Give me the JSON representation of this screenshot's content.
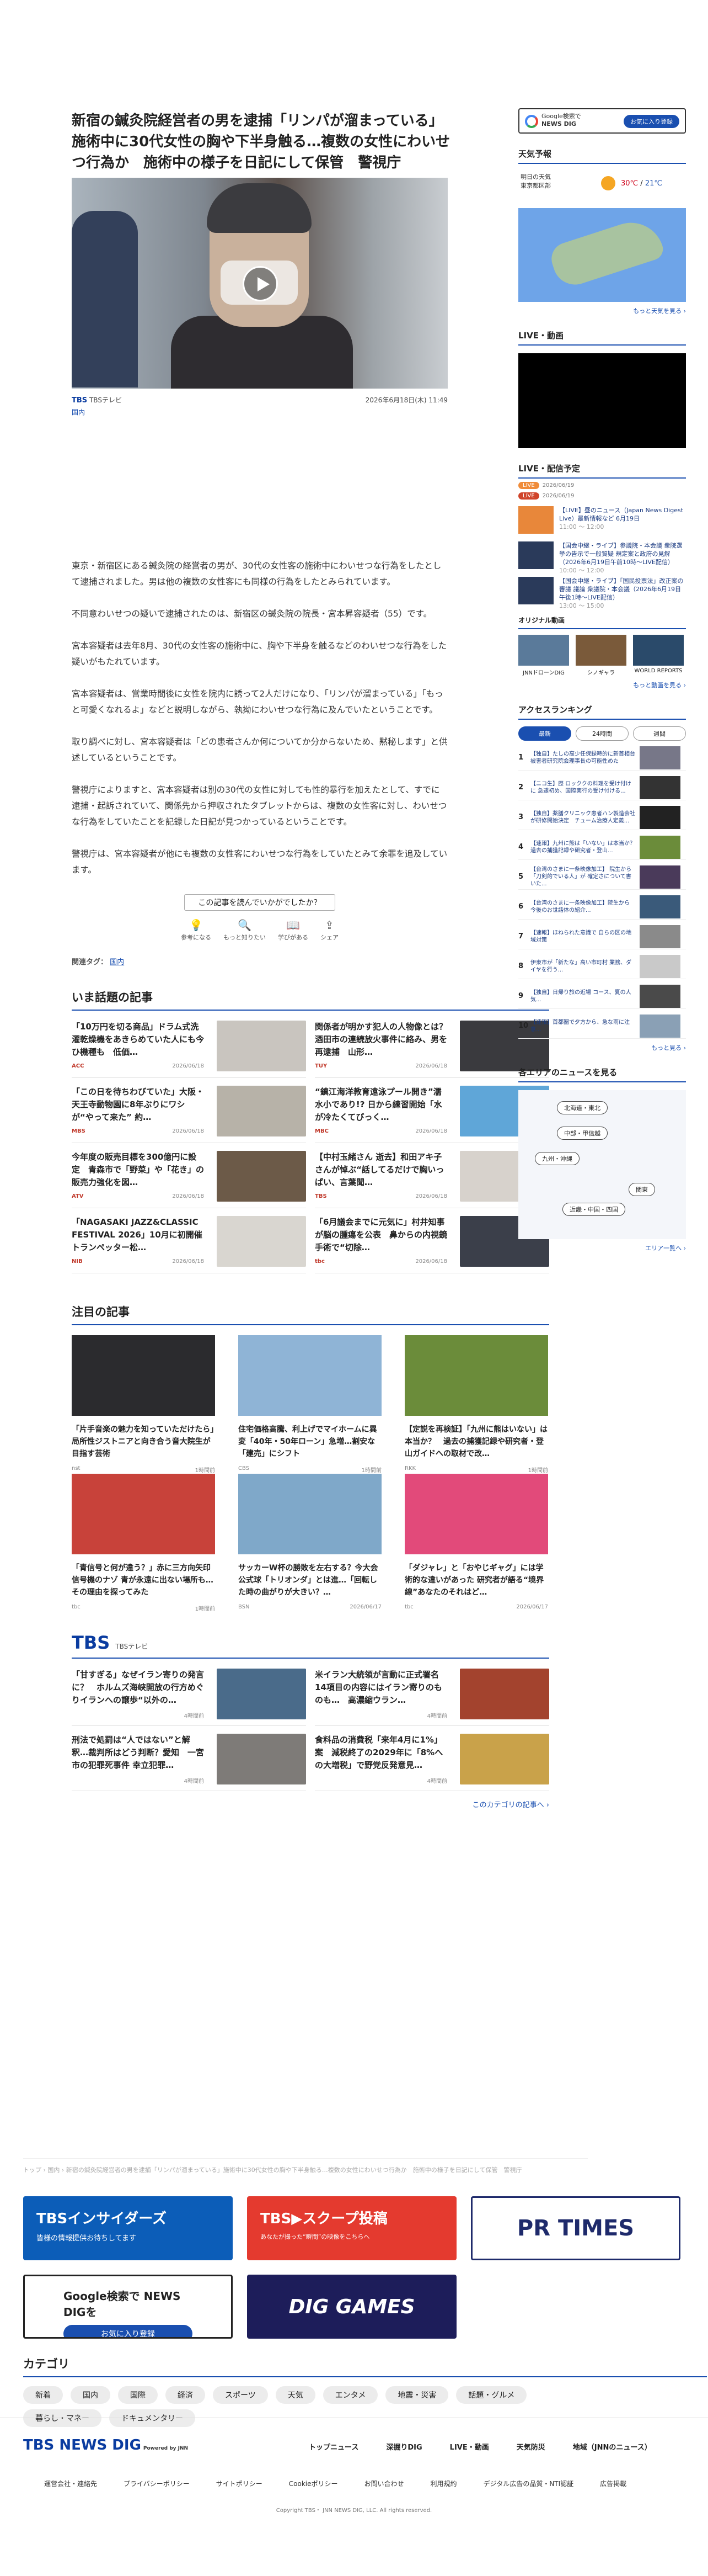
{
  "article": {
    "headline": "新宿の鍼灸院経営者の男を逮捕「リンパが溜まっている」施術中に30代女性の胸や下半身触る…複数の女性にわいせつ行為か　施術中の様子を日記にして保管　警視庁",
    "source_logo": "TBS",
    "source": "TBSテレビ",
    "date": "2026年6月18日(木) 11:49",
    "category": "国内",
    "paragraphs": [
      "東京・新宿区にある鍼灸院の経営者の男が、30代の女性客の施術中にわいせつな行為をしたとして逮捕されました。男は他の複数の女性客にも同様の行為をしたとみられています。",
      "不同意わいせつの疑いで逮捕されたのは、新宿区の鍼灸院の院長・宮本昇容疑者（55）です。",
      "宮本容疑者は去年8月、30代の女性客の施術中に、胸や下半身を触るなどのわいせつな行為をした疑いがもたれています。",
      "宮本容疑者は、営業時間後に女性を院内に誘って2人だけになり、「リンパが溜まっている」「もっと可愛くなれるよ」などと説明しながら、執拗にわいせつな行為に及んでいたということです。",
      "取り調べに対し、宮本容疑者は「どの患者さんか何についてか分からないため、黙秘します」と供述しているということです。",
      "警視庁によりますと、宮本容疑者は別の30代の女性に対しても性的暴行を加えたとして、すでに逮捕・起訴されていて、関係先から押収されたタブレットからは、複数の女性客に対し、わいせつな行為をしていたことを記録した日記が見つかっているということです。",
      "警視庁は、宮本容疑者が他にも複数の女性客にわいせつな行為をしていたとみて余罪を追及しています。"
    ],
    "survey_question": "この記事を読んでいかがでしたか？",
    "reactions": [
      "参考になる",
      "もっと知りたい",
      "学びがある",
      "シェア"
    ],
    "related_label": "関連タグ：",
    "related_tag": "国内"
  },
  "trending": {
    "title": "いま話題の記事",
    "items": [
      {
        "title": "「10万円を切る商品」ドラム式洗濯乾燥機をあきらめていた人にも今ひ機種も　低価…",
        "source": "ACC",
        "date": "2026/06/18"
      },
      {
        "title": "関係者が明かす犯人の人物像とは？ 酒田市の連続放火事件に絡み、男を再逮捕　山形…",
        "source": "TUY",
        "date": "2026/06/18"
      },
      {
        "title": "「この日を待ちわびていた」大阪・天王寺動物園に8年ぶりにワシが“やって来た” 約…",
        "source": "MBS",
        "date": "2026/06/18"
      },
      {
        "title": "“鎮江海洋教育遠泳プール開き”濡水小であり!? 日から練習開始「水が冷たくてびっく…",
        "source": "MBC",
        "date": "2026/06/18"
      },
      {
        "title": "今年度の販売目標を300億円に設定　青森市で「野菜」や「花き」の販売力強化を図…",
        "source": "ATV",
        "date": "2026/06/18"
      },
      {
        "title": "【中村玉緒さん 逝去】和田アキ子さんが悼ぶ“話してるだけで胸いっぱい、言葉聞…",
        "source": "TBS",
        "date": "2026/06/18"
      },
      {
        "title": "「NAGASAKI JAZZ&CLASSIC FESTIVAL 2026」10月に初開催　トランペッター松…",
        "source": "NIB",
        "date": "2026/06/18"
      },
      {
        "title": "「6月議会までに元気に」村井知事が脳の腫瘍を公表　鼻からの内視鏡手術で“切除…",
        "source": "tbc",
        "date": "2026/06/18"
      }
    ]
  },
  "featured": {
    "title": "注目の記事",
    "items": [
      {
        "title": "「片手音楽の魅力を知っていただけたら」局所性ジストニアと向き合う音大院生が目指す芸術",
        "source": "nst",
        "date": "1時間前"
      },
      {
        "title": "住宅価格高騰、利上げでマイホームに異変「40年・50年ローン」急増…割安な「建売」にシフト",
        "source": "CBS",
        "date": "1時間前"
      },
      {
        "title": "【定説を再検証】「九州に熊はいない」は本当か？　過去の捕獲記録や研究者・登山ガイドへの取材で改…",
        "source": "RKK",
        "date": "1時間前"
      },
      {
        "title": "「青信号と何が違う？」赤に三方向矢印 信号機のナゾ 青が永遠に出ない場所も…その理由を探ってみた",
        "source": "tbc",
        "date": "1時間前"
      },
      {
        "title": "サッカーW杯の勝敗を左右する？今大会公式球「トリオンダ」とは進…「回転した時の曲がりが大きい？…",
        "source": "BSN",
        "date": "2026/06/17"
      },
      {
        "title": "「ダジャレ」と「おやじギャグ」には学術的な違いがあった 研究者が語る“境界線”あなたのそれはど…",
        "source": "tbc",
        "date": "2026/06/17"
      }
    ]
  },
  "tbs": {
    "title": "TBS",
    "sub": "TBSテレビ",
    "items": [
      {
        "title": "「甘すぎる」なぜイラン寄りの発言に？　ホルムズ海峡開放の行方めぐりイランへの譲歩“以外の…",
        "date": "4時間前"
      },
      {
        "title": "米イラン大統領が言動に正式署名 14項目の内容にはイラン寄りのものも…　高濃縮ウラン…",
        "date": "4時間前"
      },
      {
        "title": "刑法で処罰は“人ではない”と解釈…裁判所はどう判断？愛知　一宮市の犯罪死事件 幸立犯罪…",
        "date": "4時間前"
      },
      {
        "title": "食料品の消費税「来年4月に1%」案　減税終了の2029年に「8%への大増税」で野党反発意見…",
        "date": "4時間前"
      }
    ],
    "more": "このカテゴリの記事へ ›"
  },
  "breadcrumb": "トップ ›  国内 ›  新宿の鍼灸院経営者の男を逮捕「リンパが溜まっている」施術中に30代女性の胸や下半身触る…複数の女性にわいせつ行為か　施術中の様子を日記にして保管　警視庁",
  "banners": {
    "insiders": "TBSインサイダーズ",
    "insiders_sub": "皆様の情報提供お待ちしてます",
    "scoop": "TBS▶スクープ投稿",
    "scoop_sub": "あなたが撮った“瞬間”の映像をこちらへ",
    "prtimes": "PR TIMES",
    "google": "Google検索で NEWS DIGを",
    "google_btn": "お気に入り登録",
    "games": "DIG GAMES"
  },
  "category": {
    "title": "カテゴリ",
    "chips": [
      "新着",
      "国内",
      "国際",
      "経済",
      "スポーツ",
      "天気",
      "エンタメ",
      "地震・災害",
      "話題・グルメ",
      "暮らし・マネー",
      "ドキュメンタリー"
    ]
  },
  "sidebar": {
    "google_line1": "Google検索で",
    "google_line2": "NEWS DIG",
    "google_btn": "お気に入り登録",
    "weather_title": "天気予報",
    "weather_day": "明日の天気",
    "weather_loc": "東京都区部",
    "weather_hi": "30℃",
    "weather_lo": "21℃",
    "weather_more": "もっと天気を見る ›",
    "live_title": "LIVE・動画",
    "live_sched_title": "LIVE・配信予定",
    "tag_live": "LIVE",
    "tag_date1": "2026/06/19",
    "tag_date2": "2026/06/19",
    "videos": [
      {
        "title": "【LIVE】昼のニュース（Japan News Digest Live）最新情報など 6月19日",
        "time": "11:00 ～ 12:00"
      },
      {
        "title": "【国会中継・ライブ】参議院・本会議 衆院選挙の告示で一般質疑 規定案と政府の見解（2026年6月19日午前10時～LIVE配信）",
        "time": "10:00 ～ 12:00"
      },
      {
        "title": "【国会中継・ライブ】「国民投票法」改正案の審議 議論 衆議院・本会議（2026年6月19日午後1時～LIVE配信）",
        "time": "13:00 ～ 15:00"
      }
    ],
    "orig_title": "オリジナル動画",
    "orig": [
      "JNNドローンDIG",
      "シノギャラ",
      "WORLD REPORTS"
    ],
    "video_more": "もっと動画を見る ›",
    "ranking_title": "アクセスランキング",
    "rank_tabs": [
      "最新",
      "24時間",
      "週間"
    ],
    "ranks": [
      {
        "n": "1",
        "title": "【独自】たしの高少任保録時的に新首相台 被害者研究院会理事長の可能性めた"
      },
      {
        "n": "2",
        "title": "【ニコ生】歴 ロッククの料理を受け付けに 急遽初め、国際実行の受け付ける..."
      },
      {
        "n": "3",
        "title": "【独自】薬膳クリニック患者ハン製造会社が研修開始決定　チューム治療人定義..."
      },
      {
        "n": "4",
        "title": "【速報】九州に熊は「いない」は本当か？ 過去の捕獲記録や研究者・登山..."
      },
      {
        "n": "5",
        "title": "【台湾のさまに一条映像加工】 院生から「刀剣的でいる人」が 確定さについて書いた..."
      },
      {
        "n": "6",
        "title": "【台湾のさまに一条映像加工】院生から 今後のお世話体の紹介..."
      },
      {
        "n": "7",
        "title": "【速報】ほねられた意識で 自らの区の地域対策"
      },
      {
        "n": "8",
        "title": "伊東市が「新たな」高い市町村 業務、ダイヤを行う..."
      },
      {
        "n": "9",
        "title": "【独自】日帰り旅の近場 コース、夏の人気..."
      },
      {
        "n": "10",
        "title": "【速報】首都圏で夕方から、急な雨に注意..."
      }
    ],
    "rank_more": "もっと見る ›",
    "area_title": "各エリアのニュースを見る",
    "areas": [
      "北海道・東北",
      "中部・甲信越",
      "九州・沖縄",
      "関東",
      "近畿・中国・四国"
    ],
    "area_more": "エリア一覧へ ›"
  },
  "footer": {
    "logo": "TBS NEWS DIG",
    "logo_sub": "Powered by JNN",
    "nav1": [
      "トップニュース",
      "深掘りDIG",
      "LIVE・動画",
      "天気防災",
      "地域（JNNのニュース）"
    ],
    "nav2": [
      "運営会社・連絡先",
      "プライバシーポリシー",
      "サイトポリシー",
      "Cookieポリシー",
      "お問い合わせ",
      "利用規約",
      "デジタル広告の品質・NTI認証",
      "広告掲載"
    ],
    "copyright": "Copyright TBS・ JNN NEWS DIG, LLC. All rights reserved."
  }
}
